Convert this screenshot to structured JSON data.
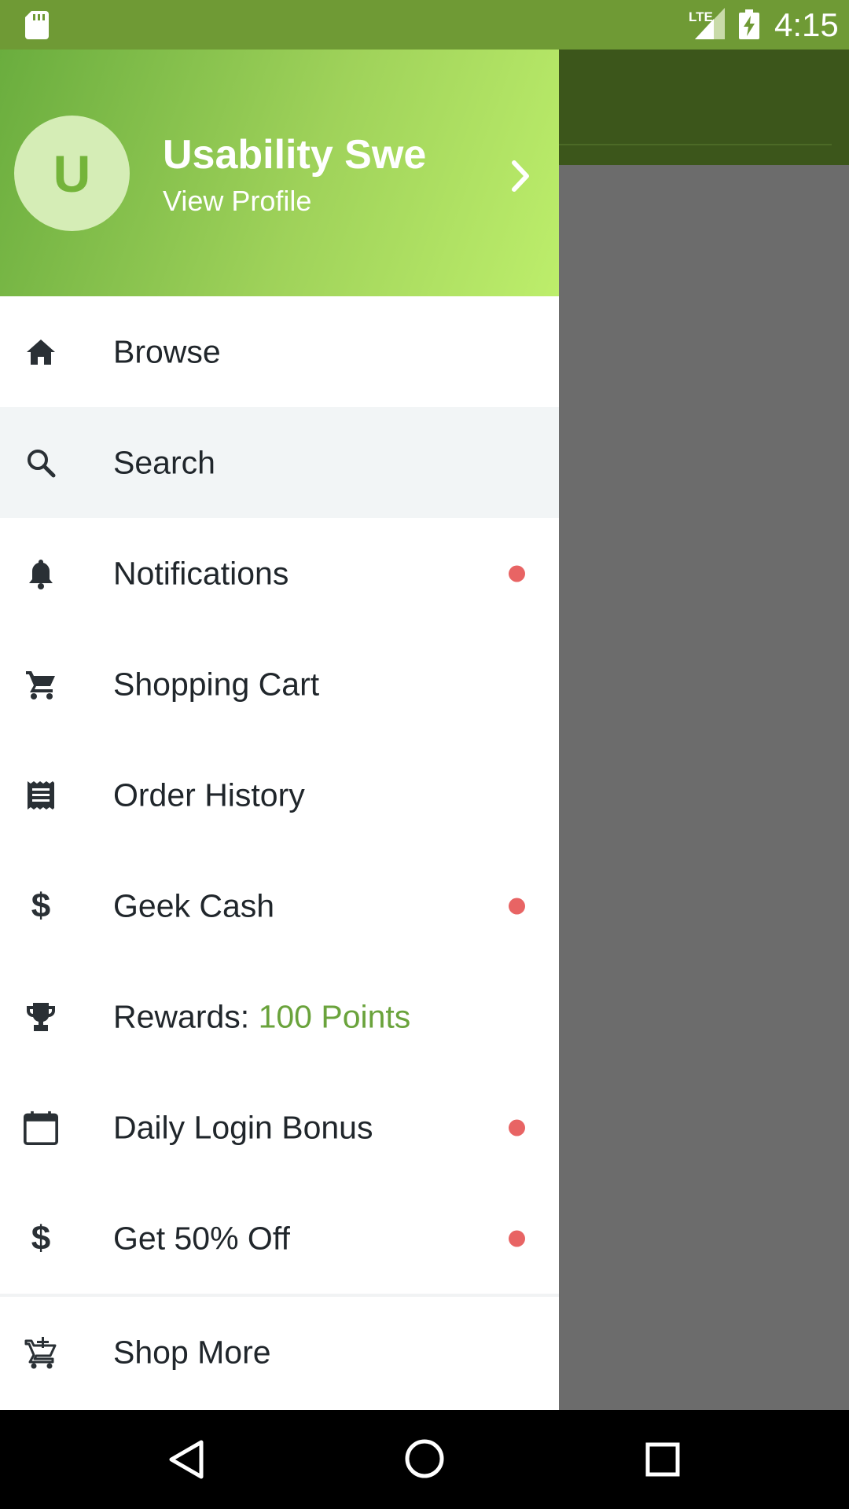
{
  "status_bar": {
    "network_label": "LTE",
    "time": "4:15"
  },
  "profile": {
    "avatar_initial": "U",
    "name": "Usability Swe",
    "view_profile": "View Profile"
  },
  "menu": [
    {
      "label": "Browse",
      "icon": "home-icon",
      "badge": false,
      "active": false
    },
    {
      "label": "Search",
      "icon": "search-icon",
      "badge": false,
      "active": true
    },
    {
      "label": "Notifications",
      "icon": "bell-icon",
      "badge": true,
      "active": false
    },
    {
      "label": "Shopping Cart",
      "icon": "cart-icon",
      "badge": false,
      "active": false
    },
    {
      "label": "Order History",
      "icon": "receipt-icon",
      "badge": false,
      "active": false
    },
    {
      "label": "Geek Cash",
      "icon": "dollar-icon",
      "badge": true,
      "active": false
    },
    {
      "label": "Rewards: ",
      "points": "100 Points",
      "icon": "trophy-icon",
      "badge": false,
      "active": false
    },
    {
      "label": "Daily Login Bonus",
      "icon": "calendar-icon",
      "badge": true,
      "active": false
    },
    {
      "label": "Get 50% Off",
      "icon": "dollar-icon",
      "badge": true,
      "active": false
    },
    {
      "label": "Shop More",
      "icon": "add-cart-icon",
      "badge": false,
      "active": false
    }
  ],
  "colors": {
    "status_bar": "#6f9a35",
    "accent_green": "#6aa33c",
    "badge_red": "#e86464",
    "active_row": "#f2f5f6"
  }
}
